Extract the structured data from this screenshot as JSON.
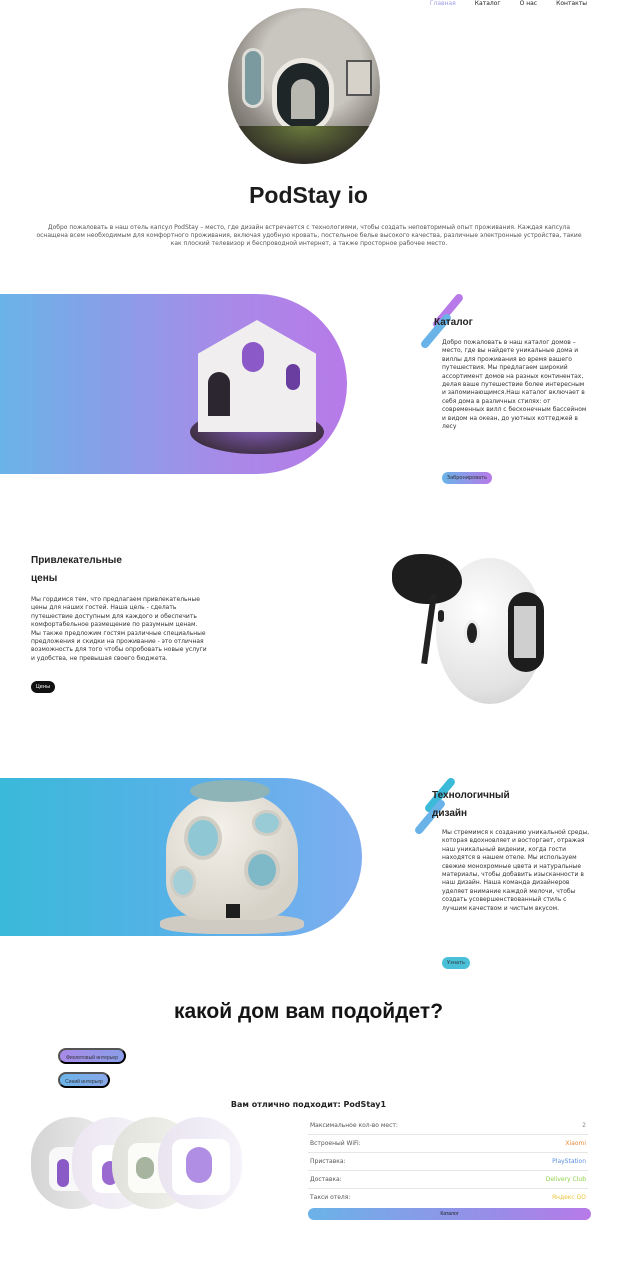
{
  "nav": {
    "items": [
      {
        "label": "Главная",
        "active": true
      },
      {
        "label": "Каталог",
        "active": false
      },
      {
        "label": "О нас",
        "active": false
      },
      {
        "label": "Контакты",
        "active": false
      }
    ]
  },
  "hero": {
    "title": "PodStay io",
    "text": "Добро пожаловать в наш отель капсул PodStay – место, где дизайн встречается с технологиями, чтобы создать неповторимый опыт проживания. Каждая капсула оснащена всем необходимым для комфортного проживания, включая удобную кровать, постельное белье высокого качества, различные электронные устройства, такие как плоский телевизор и беспроводной интернет, а также просторное рабочее место."
  },
  "catalog_section": {
    "title": "Каталог",
    "text": "Добро пожаловать в наш каталог домов – место, где вы найдете уникальные дома и виллы для проживания во время вашего путешествия. Мы предлагаем широкий ассортимент домов на разных континентах, делая ваше путешествие более интересным и запоминающимся.Наш каталог включает в себя дома в различных стилях: от современных вилл с бесконечным бассейном и видом на океан, до уютных коттеджей в лесу",
    "button": "Забронировать"
  },
  "prices_section": {
    "title_line1": "Привлекательные",
    "title_line2": "цены",
    "text": "Мы гордимся тем, что предлагаем привлекательные цены для наших гостей. Наша цель - сделать путешествие доступным для каждого и обеспечить комфортабельное размещение по разумным ценам. Мы также предложим гостям различные специальные предложения и скидки на проживание - это отличная возможность для того чтобы опробовать новые услуги и удобства, не превышая своего бюджета.",
    "button": "Цены"
  },
  "design_section": {
    "title_line1": "Технологичный",
    "title_line2": "дизайн",
    "text": "Мы стремимся к созданию уникальной среды, которая вдохновляет и восторгает, отражая наш уникальный видении, когда гости находятся в нашем отеле. Мы используем свежие монохромные цвета и натуральные материалы, чтобы добавить изысканности в наш дизайн. Наша команда дизайнеров уделяет внимание каждой мелочи, чтобы создать усовершенствованный стиль с лучшим качеством и чистым вкусом.",
    "button": "Узнать"
  },
  "quiz": {
    "title": "какой дом вам подойдет?",
    "options": [
      "Фиолетовый интерьер",
      "Синий интерьер"
    ],
    "result_title": "Вам отлично подходит: PodStay1",
    "specs": [
      {
        "key": "Максимальное кол-во мест:",
        "value": "2",
        "color": "#888888"
      },
      {
        "key": "Встроеный WiFi:",
        "value": "Xiaomi",
        "color": "#e58a3a"
      },
      {
        "key": "Приставка:",
        "value": "PlayStation",
        "color": "#5b8fe0"
      },
      {
        "key": "Доставка:",
        "value": "Delivery Club",
        "color": "#8fcf4a"
      },
      {
        "key": "Такси отеля:",
        "value": "Яндекс GO",
        "color": "#e8c43a"
      }
    ],
    "catalog_button": "Каталог"
  },
  "colors": {
    "accent_purple": "#b77ae8",
    "accent_blue": "#6ab3e8",
    "nav_active": "#9c9ce6"
  }
}
